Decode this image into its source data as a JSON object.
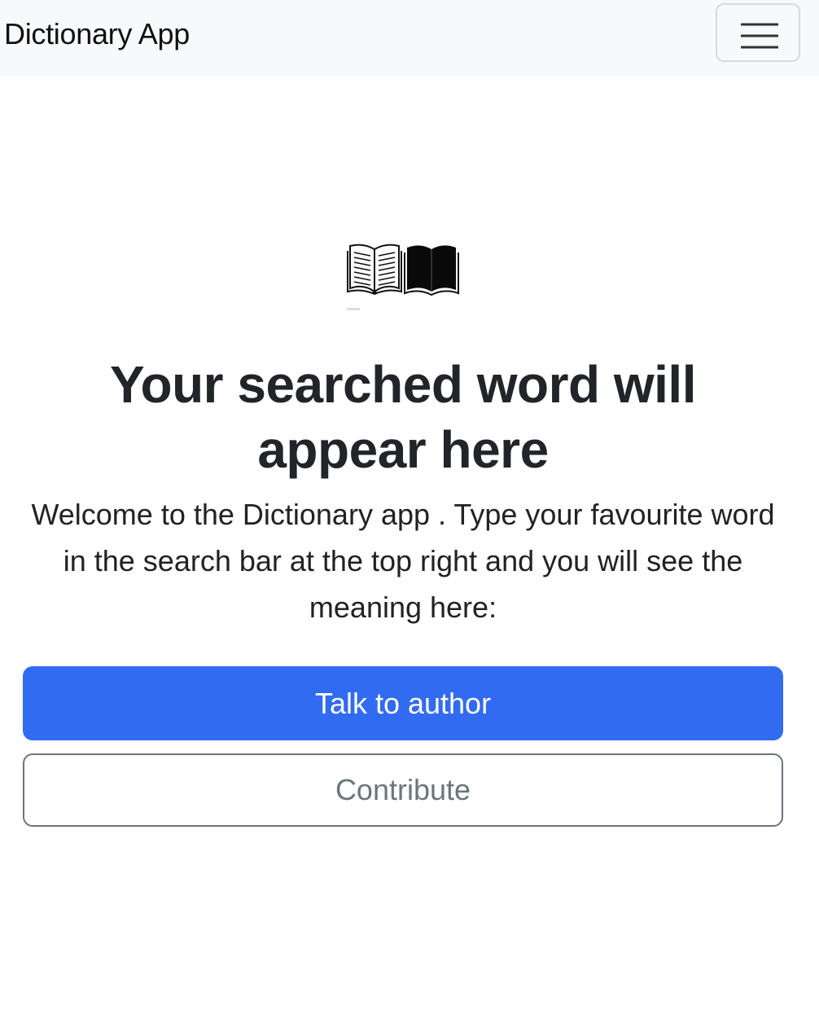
{
  "navbar": {
    "brand": "Dictionary App",
    "toggle_icon": "hamburger-menu-icon"
  },
  "hero": {
    "icon": "open-book-icon",
    "heading": "Your searched word will appear here",
    "description": "Welcome to the Dictionary app . Type your favourite word in the search bar at the top right and you will see the meaning here:"
  },
  "actions": {
    "talk_label": "Talk to author",
    "contribute_label": "Contribute"
  },
  "colors": {
    "navbar_bg": "#f8f9fa",
    "primary": "#316bf1",
    "secondary": "#6c757d"
  }
}
